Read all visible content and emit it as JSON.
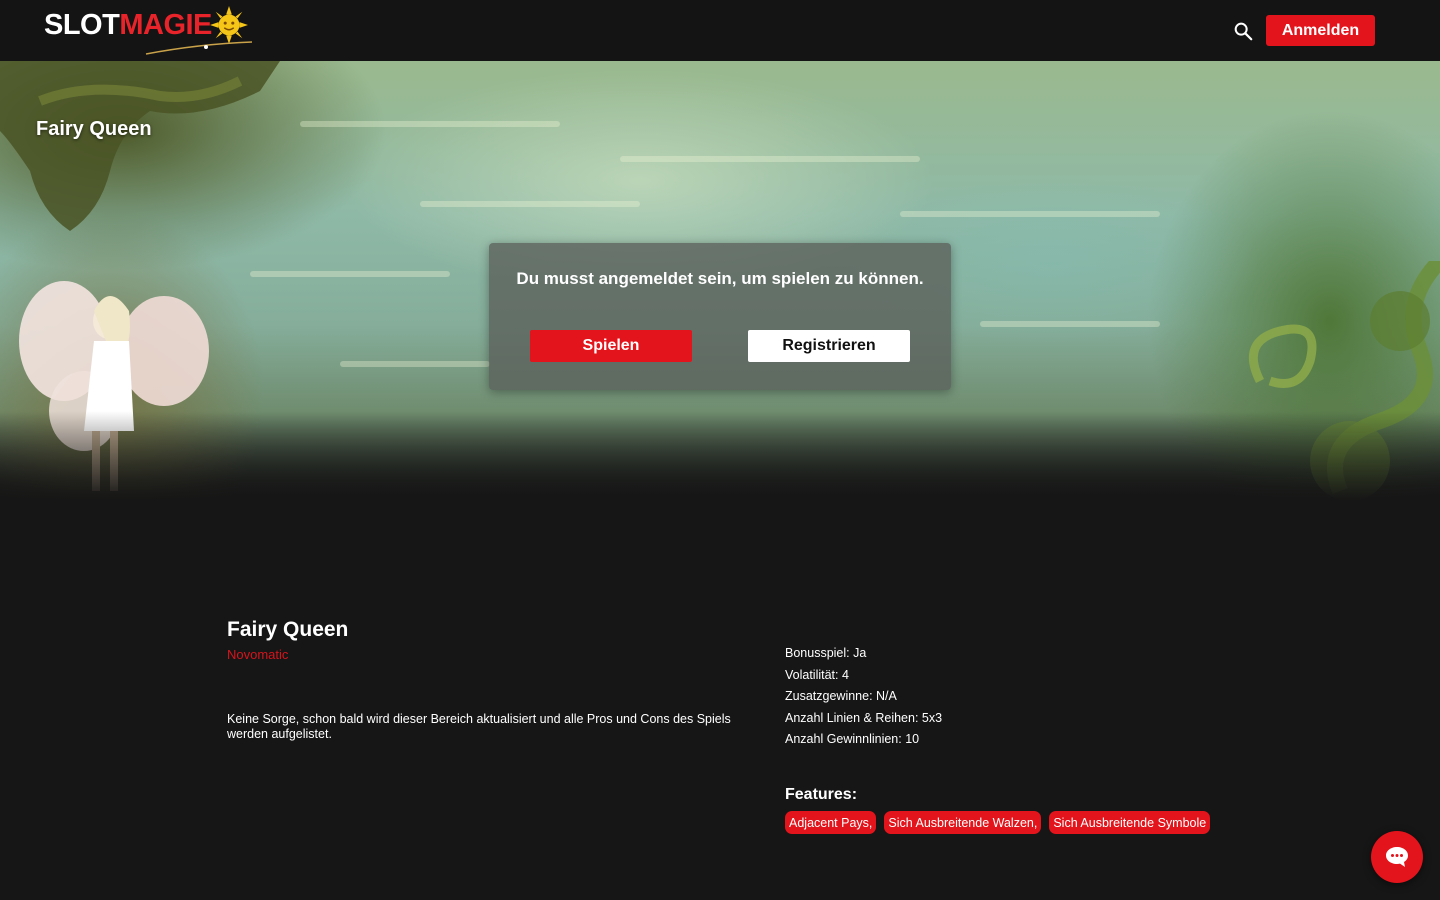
{
  "header": {
    "logo": {
      "text_white": "SLOT",
      "text_red": "MAGIE"
    },
    "search_icon": "search-icon",
    "login_label": "Anmelden"
  },
  "hero": {
    "title": "Fairy Queen",
    "modal": {
      "message": "Du musst angemeldet sein, um spielen zu können.",
      "play_label": "Spielen",
      "register_label": "Registrieren"
    }
  },
  "game": {
    "title": "Fairy Queen",
    "provider": "Novomatic",
    "description": "Keine Sorge, schon bald wird dieser Bereich aktualisiert und alle Pros und Cons des Spiels werden aufgelistet.",
    "specs": [
      "Bonusspiel: Ja",
      "Volatilität: 4",
      "Zusatzgewinne: N/A",
      "Anzahl Linien & Reihen: 5x3",
      "Anzahl Gewinnlinien: 10"
    ],
    "features_title": "Features:",
    "features": [
      "Adjacent Pays,",
      "Sich Ausbreitende Walzen,",
      "Sich Ausbreitende Symbole"
    ]
  },
  "chat": {
    "icon": "chat-bubble-icon"
  },
  "colors": {
    "accent": "#e3141b",
    "background": "#161616",
    "header": "#141414"
  }
}
